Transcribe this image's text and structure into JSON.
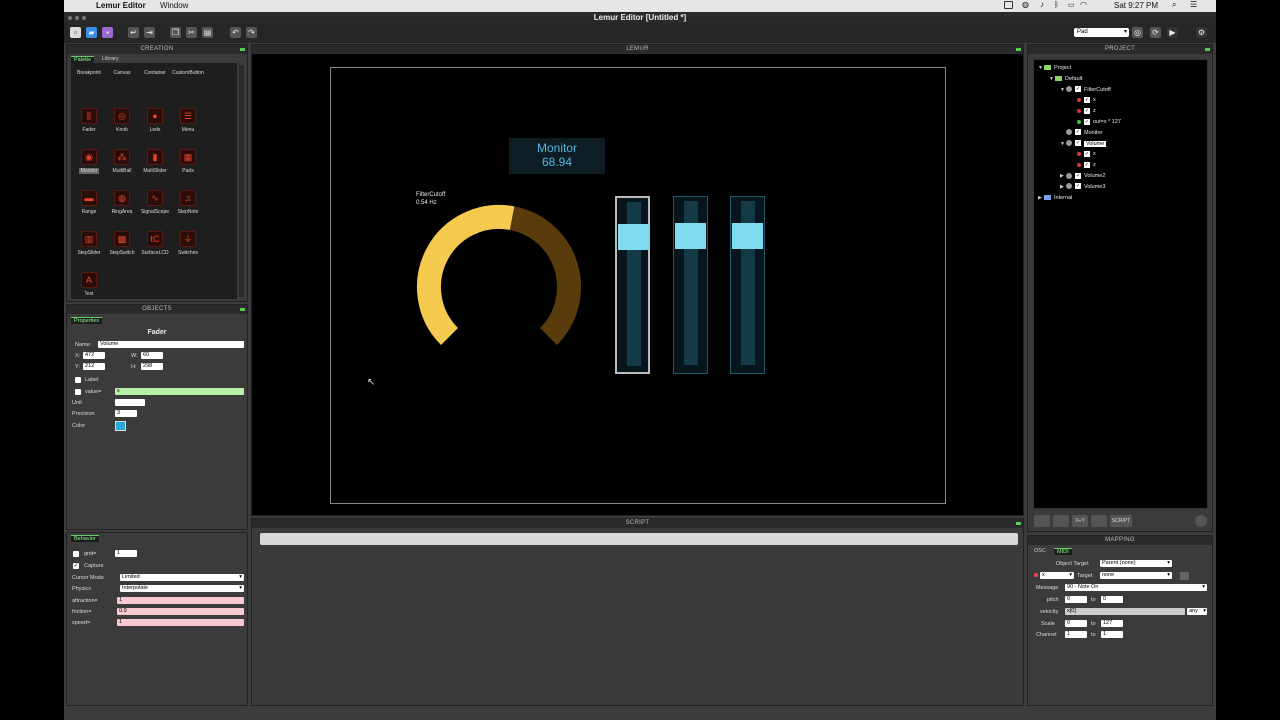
{
  "menubar": {
    "apple": "",
    "app": "Lemur Editor",
    "window": "Window",
    "clock": "Sat 9:27 PM"
  },
  "titlebar": {
    "title": "Lemur Editor [Untitled *]"
  },
  "toolbar": {
    "device_select": "Pad"
  },
  "creation": {
    "title": "CREATION",
    "tabs": [
      "Palette",
      "Library"
    ],
    "items": [
      {
        "name": "Breakpoint",
        "glyph": "◆"
      },
      {
        "name": "Canvas",
        "glyph": "▭"
      },
      {
        "name": "Container",
        "glyph": "▭"
      },
      {
        "name": "CustomButton",
        "glyph": "▭"
      },
      {
        "name": "Fader",
        "glyph": "⫼"
      },
      {
        "name": "Knob",
        "glyph": "◎"
      },
      {
        "name": "Leds",
        "glyph": "●"
      },
      {
        "name": "Menu",
        "glyph": "☰"
      },
      {
        "name": "Monitor",
        "glyph": "◉"
      },
      {
        "name": "MultiBall",
        "glyph": "⁂"
      },
      {
        "name": "MultiSlider",
        "glyph": "▮"
      },
      {
        "name": "Pads",
        "glyph": "▦"
      },
      {
        "name": "Range",
        "glyph": "▬"
      },
      {
        "name": "RingArea",
        "glyph": "◍"
      },
      {
        "name": "SignalScope",
        "glyph": "∿"
      },
      {
        "name": "StepNote",
        "glyph": "♫"
      },
      {
        "name": "StepSlider",
        "glyph": "▥"
      },
      {
        "name": "StepSwitch",
        "glyph": "▩"
      },
      {
        "name": "SurfaceLCD",
        "glyph": "tC"
      },
      {
        "name": "Switches",
        "glyph": "⏚"
      },
      {
        "name": "Text",
        "glyph": "A"
      }
    ]
  },
  "objects": {
    "title": "OBJECTS",
    "tab": "Properties",
    "heading": "Fader",
    "name_label": "Name:",
    "name_value": "Volume",
    "x_label": "X:",
    "x_value": "472",
    "w_label": "W:",
    "w_value": "60",
    "y_label": "Y:",
    "y_value": "212",
    "h_label": "H:",
    "h_value": "298",
    "label_label": "Label",
    "value_label": "value=",
    "value_value": "x",
    "unit_label": "Unit",
    "unit_value": "",
    "precision_label": "Precision",
    "precision_value": "3",
    "color_label": "Color",
    "color_value": "#2aa7d6"
  },
  "behavior": {
    "tab": "Behavior",
    "grid_label": "grid=",
    "grid_value": "1",
    "capture_label": "Capture",
    "cursor_label": "Cursor Mode",
    "cursor_value": "Limited",
    "physics_label": "Physics",
    "physics_value": "Interpolate",
    "attraction_label": "attraction=",
    "attraction_value": "1",
    "friction_label": "friction=",
    "friction_value": "0.9",
    "speed_label": "speed=",
    "speed_value": "1"
  },
  "lemur": {
    "title": "LEMUR",
    "monitor": {
      "label": "Monitor",
      "value": "68.94"
    },
    "knob": {
      "label": "FilterCutoff",
      "value": "0.54 Hz",
      "level": 0.54,
      "track_color": "#5a3c0c",
      "fill_color": "#f5cb4f"
    },
    "faders": [
      {
        "level": 0.85
      },
      {
        "level": 0.85
      },
      {
        "level": 0.85
      }
    ],
    "fader_color": "#7fdcf0"
  },
  "script": {
    "title": "SCRIPT"
  },
  "project": {
    "title": "PROJECT",
    "tree": [
      {
        "text": "Project",
        "icon": "folder",
        "indent": 0,
        "arrow": "▼"
      },
      {
        "text": "Default",
        "icon": "folder",
        "indent": 1,
        "arrow": "▼"
      },
      {
        "text": "FilterCutoff",
        "icon": "object",
        "indent": 2,
        "arrow": "▼"
      },
      {
        "text": "x",
        "icon": "var-red",
        "indent": 3,
        "arrow": ""
      },
      {
        "text": "z",
        "icon": "var-red",
        "indent": 3,
        "arrow": ""
      },
      {
        "text": "out=x * 127",
        "icon": "var-green",
        "indent": 3,
        "arrow": ""
      },
      {
        "text": "Monitor",
        "icon": "object-nochk",
        "indent": 2,
        "arrow": ""
      },
      {
        "text": "Volume",
        "icon": "object",
        "indent": 2,
        "arrow": "▼",
        "selected": true
      },
      {
        "text": "x",
        "icon": "var-red",
        "indent": 3,
        "arrow": ""
      },
      {
        "text": "z",
        "icon": "var-red",
        "indent": 3,
        "arrow": ""
      },
      {
        "text": "Volume2",
        "icon": "object",
        "indent": 2,
        "arrow": "▶"
      },
      {
        "text": "Volume3",
        "icon": "object",
        "indent": 2,
        "arrow": "▶"
      },
      {
        "text": "Internal",
        "icon": "folder-blue",
        "indent": 0,
        "arrow": "▶"
      }
    ],
    "buttons": [
      "",
      "",
      "X+Y",
      "",
      "SCRIPT"
    ]
  },
  "mapping": {
    "title": "MAPPING",
    "tabs": [
      "OSC",
      "MIDI"
    ],
    "object_target_label": "Object Target",
    "object_target_value": "Parent (none)",
    "var_value": "x",
    "target_label": "Target",
    "target_value": "none",
    "message_label": "Message",
    "message_value": "90 - Note On",
    "pitch_label": "pitch",
    "pitch_from": "0",
    "pitch_to_label": "to",
    "pitch_to": "0",
    "velocity_label": "velocity",
    "velocity_value": "x[0]",
    "velocity_any": "any",
    "scale_label": "Scale",
    "scale_from": "0",
    "scale_to_label": "to",
    "scale_to": "127",
    "channel_label": "Channel",
    "channel_from": "1",
    "channel_to_label": "to",
    "channel_to": "1"
  }
}
